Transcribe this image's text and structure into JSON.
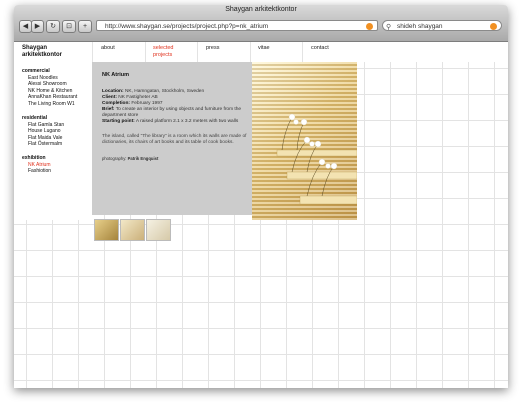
{
  "window": {
    "title": "Shaygan arkitektkontor"
  },
  "toolbar": {
    "back_label": "◀",
    "forward_label": "▶",
    "reload_label": "↻",
    "bookmark_label": "⊡",
    "add_label": "+",
    "url": "http://www.shaygan.se/projects/project.php?p=nk_atrium",
    "search_value": "shideh shaygan"
  },
  "logo": {
    "line1": "Shaygan",
    "line2": "arkitektkontor"
  },
  "nav": {
    "about": "about",
    "selected_line1": "selected",
    "selected_line2": "projects",
    "press": "press",
    "vitae": "vitae",
    "contact": "contact"
  },
  "sidebar": {
    "commercial_head": "commercial",
    "commercial": [
      "East Noodles",
      "Alessi Showroom",
      "NK Home & Kitchen",
      "AnnaKhan Restaurant",
      "The Living Room W1"
    ],
    "residential_head": "residential",
    "residential": [
      "Flat Gamla Stan",
      "House Lugano",
      "Flat Maida Vale",
      "Flat Östermalm"
    ],
    "exhibition_head": "exhibition",
    "exhibition": [
      "NK Atrium",
      "Fashiotion"
    ]
  },
  "project": {
    "title": "NK Atrium",
    "location_label": "Location:",
    "location": "NK, Hamngatan, Stockholm, Sweden",
    "client_label": "Client:",
    "client": "NK Fastigheter AB",
    "completion_label": "Completion:",
    "completion": "February 1997",
    "brief_label": "Brief:",
    "brief": "To create an interior by using objects and furniture from the department store",
    "starting_label": "Starting point:",
    "starting": "A raised platform 2.1 x 3.2 meters with two walls",
    "description": "The island, called \"The library\" is a room which its walls are made of dictionaries, its chairs of art books and its table of cook books.",
    "photography_label": "photography:",
    "photographer": "Patrik Engquist"
  },
  "colors": {
    "accent": "#e0321e",
    "panel": "#cccccc",
    "rss": "#f19022"
  },
  "icons": {
    "search": "search-icon",
    "rss": "rss-icon"
  }
}
